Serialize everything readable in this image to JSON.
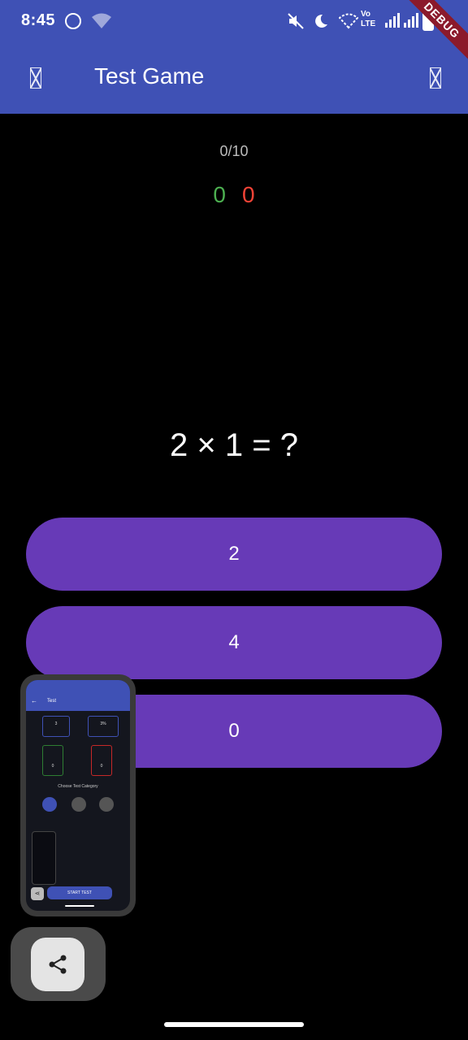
{
  "status_bar": {
    "time": "8:45",
    "icons": [
      "whatsapp-icon",
      "wifi-question-icon",
      "mute-icon",
      "moon-icon",
      "wifi-icon",
      "volte-icon",
      "signal-icon",
      "battery-icon"
    ],
    "volte_line1": "Vo",
    "volte_line2": "LTE",
    "wifi_question": "?",
    "debug_label": "DEBUG"
  },
  "app_bar": {
    "title": "Test Game",
    "left_icon": "missing-glyph-icon",
    "right_icon": "missing-glyph-icon",
    "background": "#3f51b5"
  },
  "game": {
    "progress": "0/10",
    "correct_count": "0",
    "wrong_count": "0",
    "question": "2 × 1 = ?",
    "answers": [
      "2",
      "4",
      "0"
    ],
    "answer_color": "#673ab7",
    "correct_color": "#4caf50",
    "wrong_color": "#f44336"
  },
  "preview": {
    "screen_title": "Test",
    "start_label": "START TEST",
    "category_label": "Choose Test Category",
    "stat_value_1": "3",
    "stat_value_2": "3%",
    "correct_value": "0",
    "wrong_value": "0"
  },
  "share": {
    "icon": "share-icon"
  }
}
